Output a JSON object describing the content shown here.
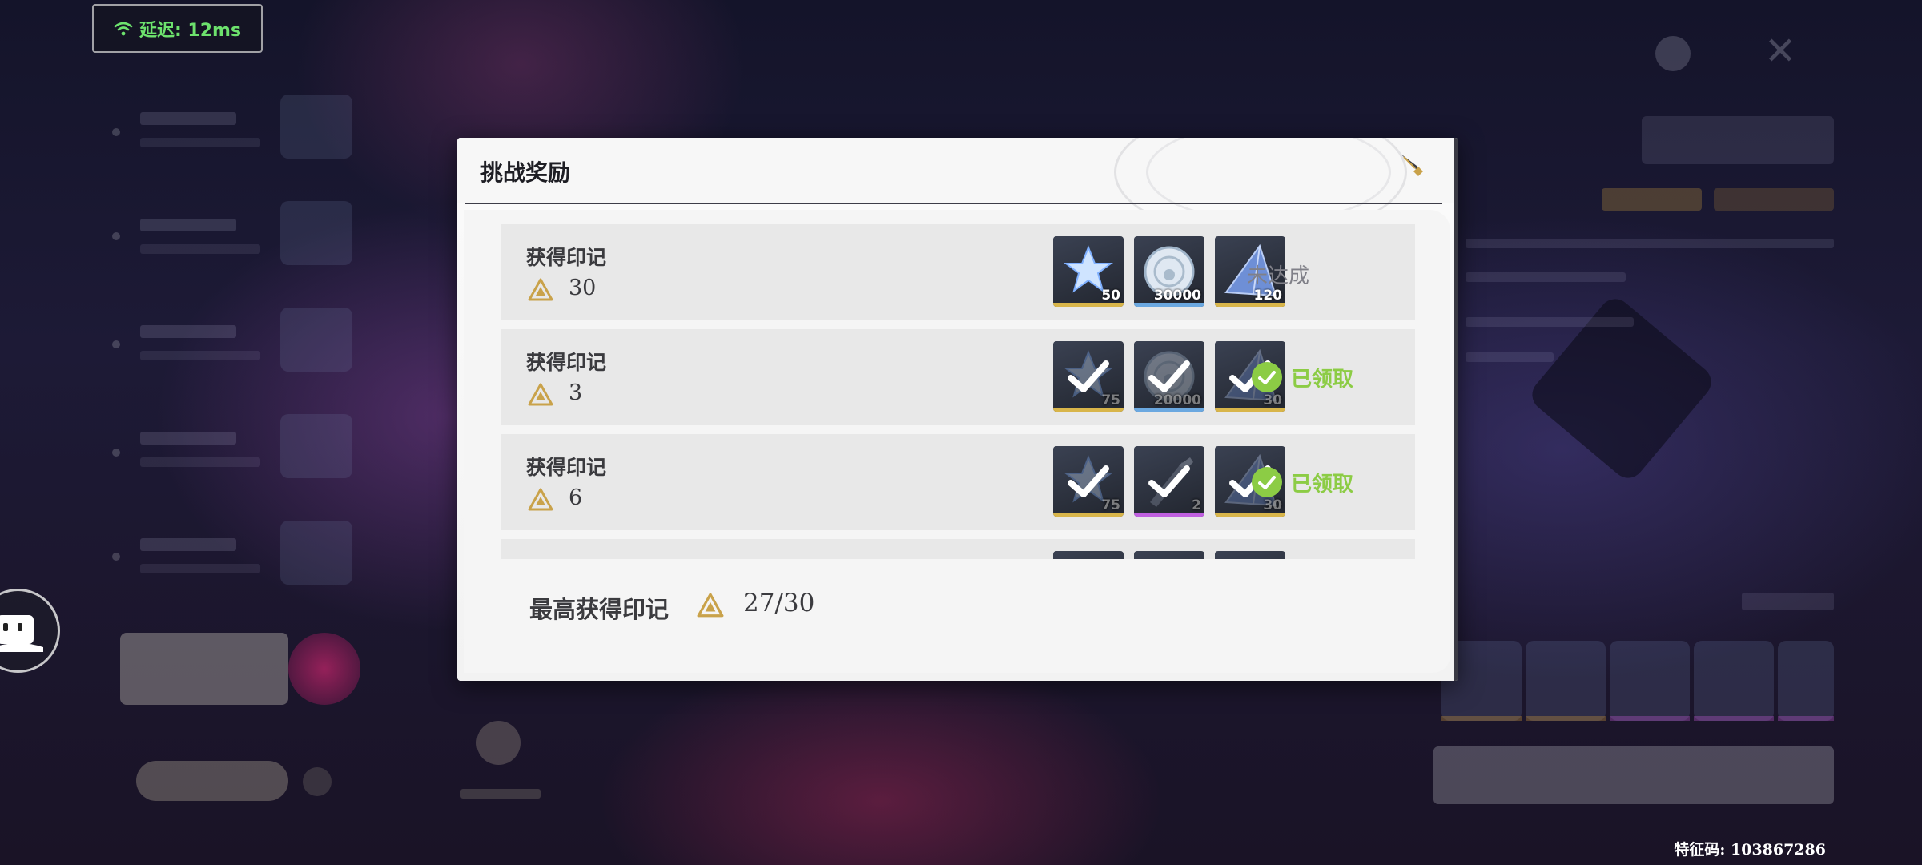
{
  "hud": {
    "latency": "延迟: 12ms",
    "feature_code": "特征码: 103867286"
  },
  "modal": {
    "title": "挑战奖励",
    "rows": [
      {
        "label": "获得印记",
        "value": "30",
        "status": "未达成",
        "claimed": false,
        "items": [
          {
            "icon": "star-crystal-icon",
            "qty": "50",
            "rarity_color": "#d8b54a"
          },
          {
            "icon": "shell-coin-icon",
            "qty": "30000",
            "rarity_color": "#6ba8e0"
          },
          {
            "icon": "blue-crystal-icon",
            "qty": "120",
            "rarity_color": "#d8b54a"
          }
        ]
      },
      {
        "label": "获得印记",
        "value": "3",
        "status": "已领取",
        "claimed": true,
        "items": [
          {
            "icon": "star-crystal-icon",
            "qty": "75",
            "rarity_color": "#d8b54a"
          },
          {
            "icon": "shell-coin-icon",
            "qty": "20000",
            "rarity_color": "#6ba8e0"
          },
          {
            "icon": "blue-crystal-icon",
            "qty": "30",
            "rarity_color": "#d8b54a"
          }
        ]
      },
      {
        "label": "获得印记",
        "value": "6",
        "status": "已领取",
        "claimed": true,
        "items": [
          {
            "icon": "star-crystal-icon",
            "qty": "75",
            "rarity_color": "#d8b54a"
          },
          {
            "icon": "tuner-icon",
            "qty": "2",
            "rarity_color": "#c060e0"
          },
          {
            "icon": "blue-crystal-icon",
            "qty": "30",
            "rarity_color": "#d8b54a"
          }
        ]
      },
      {
        "label": "",
        "value": "",
        "status": "",
        "claimed": true,
        "items": [
          {
            "icon": "item-icon",
            "qty": "",
            "rarity_color": "#d8b54a"
          },
          {
            "icon": "item-icon",
            "qty": "",
            "rarity_color": "#d8b54a"
          },
          {
            "icon": "item-icon",
            "qty": "",
            "rarity_color": "#d8b54a"
          }
        ]
      }
    ],
    "footer": {
      "label": "最高获得印记",
      "value": "27/30"
    }
  },
  "colors": {
    "accent_gold": "#c9a24a",
    "claimed_green": "#8ccc45",
    "latency_green": "#6de26d"
  }
}
